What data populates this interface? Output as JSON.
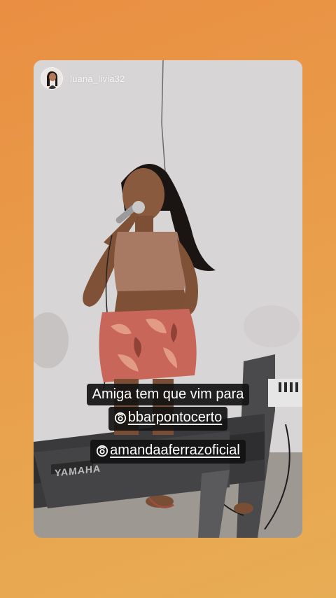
{
  "story": {
    "username": "luana_livia32",
    "caption_line1": "Amiga tem que vim para",
    "mention1": "bbarpontocerto",
    "mention2": "amandaaferrazoficial",
    "keyboard_brand": "YAMAHA"
  },
  "colors": {
    "background_start": "#e98e42",
    "background_end": "#e7ad55",
    "caption_bg": "#121212",
    "caption_text": "#ffffff"
  },
  "icons": {
    "mention": "mention-at-icon",
    "avatar": "profile-avatar"
  }
}
